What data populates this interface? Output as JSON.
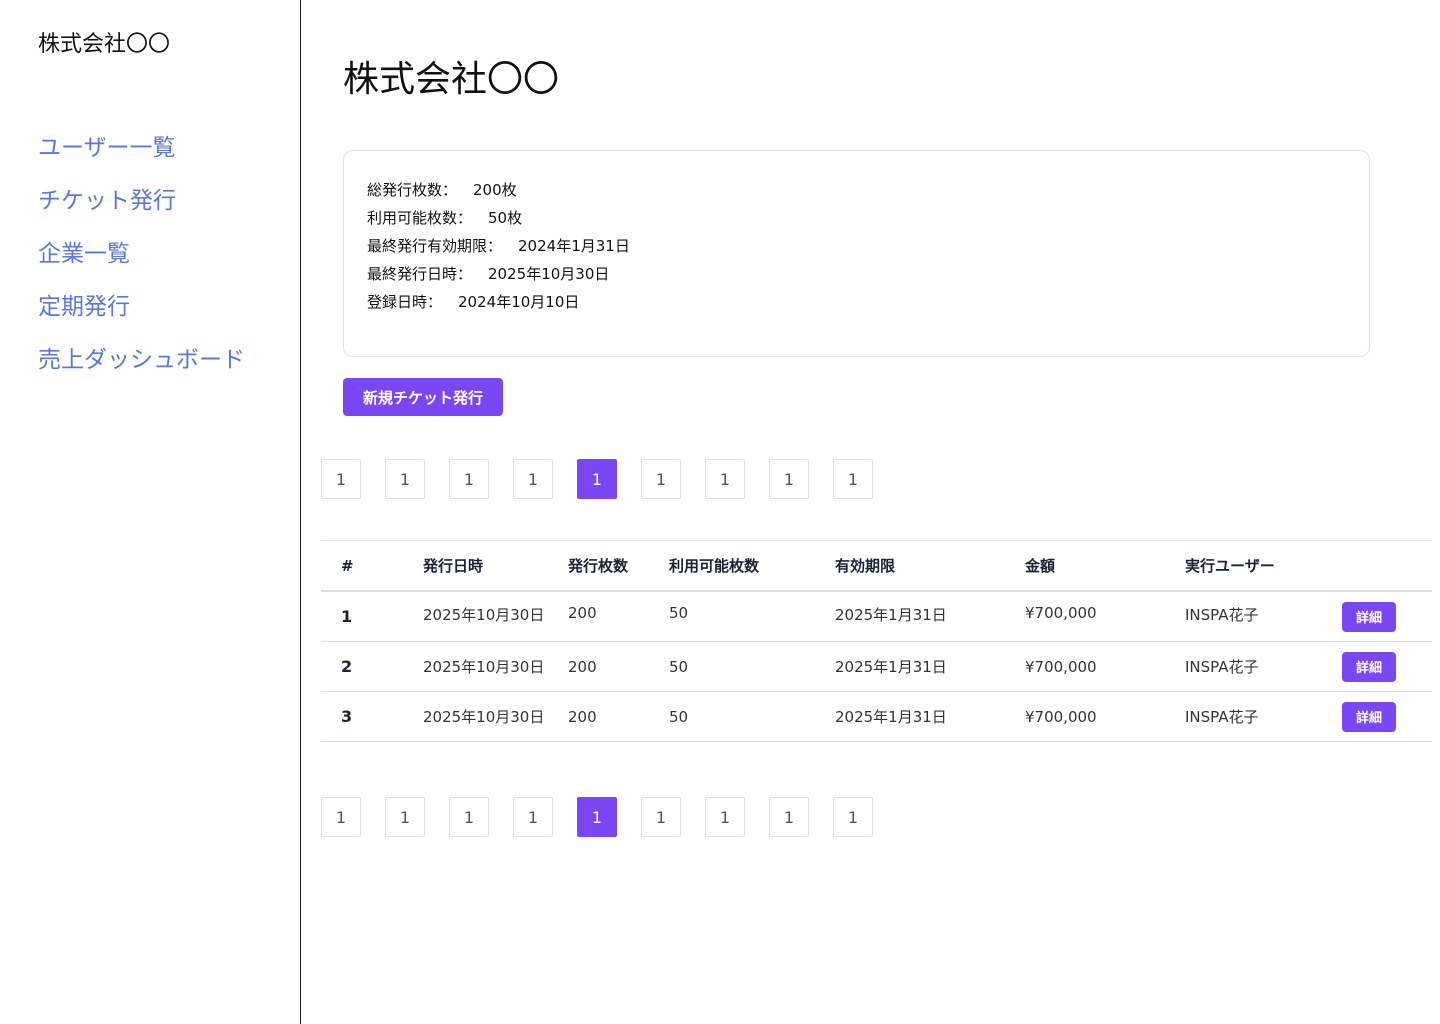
{
  "sidebar": {
    "title": "株式会社〇〇",
    "items": [
      {
        "label": "ユーザー一覧"
      },
      {
        "label": "チケット発行"
      },
      {
        "label": "企業一覧"
      },
      {
        "label": "定期発行"
      },
      {
        "label": "売上ダッシュボード"
      }
    ]
  },
  "main": {
    "title": "株式会社〇〇",
    "info": [
      {
        "label": "総発行枚数：",
        "value": "200枚"
      },
      {
        "label": "利用可能枚数：",
        "value": "50枚"
      },
      {
        "label": "最終発行有効期限：",
        "value": "2024年1月31日"
      },
      {
        "label": "最終発行日時：",
        "value": "2025年10月30日"
      },
      {
        "label": "登録日時：",
        "value": "2024年10月10日"
      }
    ],
    "new_ticket_button": "新規チケット発行",
    "pagination": {
      "pages": [
        "1",
        "1",
        "1",
        "1",
        "1",
        "1",
        "1",
        "1",
        "1"
      ],
      "active_index": 4
    },
    "table": {
      "headers": [
        "#",
        "発行日時",
        "発行枚数",
        "利用可能枚数",
        "有効期限",
        "金額",
        "実行ユーザー",
        ""
      ],
      "detail_label": "詳細",
      "rows": [
        {
          "num": "1",
          "issued_at": "2025年10月30日",
          "count": "200",
          "available": "50",
          "expiry": "2025年1月31日",
          "amount": "¥700,000",
          "user": "INSPA花子"
        },
        {
          "num": "2",
          "issued_at": "2025年10月30日",
          "count": "200",
          "available": "50",
          "expiry": "2025年1月31日",
          "amount": "¥700,000",
          "user": "INSPA花子"
        },
        {
          "num": "3",
          "issued_at": "2025年10月30日",
          "count": "200",
          "available": "50",
          "expiry": "2025年1月31日",
          "amount": "¥700,000",
          "user": "INSPA花子"
        }
      ]
    }
  },
  "colors": {
    "accent": "#7b47f5",
    "nav_link": "#5b78d9",
    "border": "#e2e2e2"
  }
}
